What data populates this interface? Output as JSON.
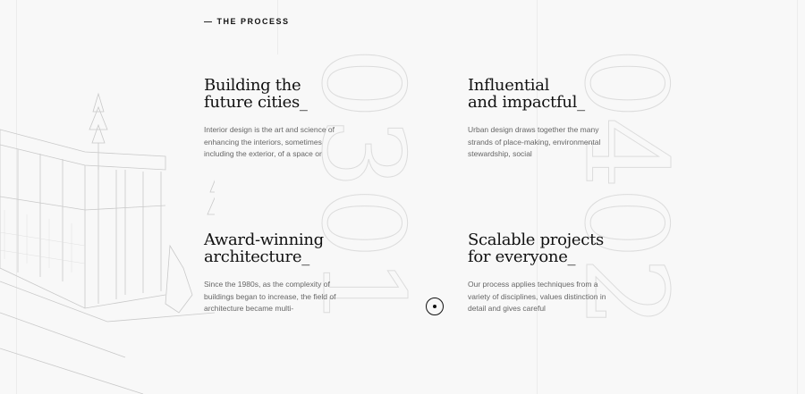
{
  "section": {
    "eyebrow": "— THE PROCESS"
  },
  "numbers": {
    "left": "0301",
    "right": "0402"
  },
  "cards": [
    {
      "title_line1": "Building the",
      "title_line2": "future cities_",
      "body": "Interior design is the art and science of enhancing the interiors, sometimes including the exterior, of a space or"
    },
    {
      "title_line1": "Influential",
      "title_line2": "and impactful_",
      "body": "Urban design draws together the many strands of place-making, environmental stewardship, social"
    },
    {
      "title_line1": "Award-winning",
      "title_line2": "architecture_",
      "body": "Since the 1980s, as the complexity of buildings began to increase, the field of architecture became multi-"
    },
    {
      "title_line1": "Scalable projects",
      "title_line2": "for everyone_",
      "body": "Our process applies techniques from a variety of disciplines, values distinction in detail and gives careful"
    }
  ],
  "colors": {
    "background": "#f8f8f8",
    "heading": "#111111",
    "body_text": "#666666",
    "outline_numbers": "#dcdcdc"
  }
}
